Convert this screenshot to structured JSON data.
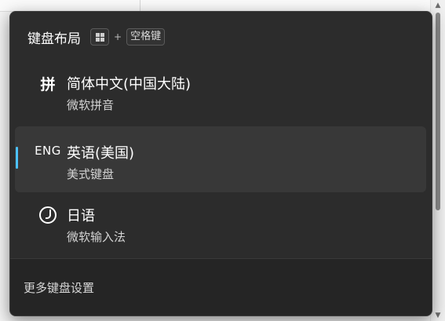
{
  "flyout": {
    "title": "键盘布局",
    "shortcut_plus": "+",
    "shortcut_space": "空格键",
    "items": [
      {
        "glyph": "拼",
        "name": "简体中文(中国大陆)",
        "sub": "微软拼音",
        "selected": false
      },
      {
        "glyph": "ENG",
        "name": "英语(美国)",
        "sub": "美式键盘",
        "selected": true
      },
      {
        "glyph": "japanese-ime-icon",
        "name": "日语",
        "sub": "微软输入法",
        "selected": false
      }
    ],
    "footer_link": "更多键盘设置"
  },
  "colors": {
    "flyout_bg": "#2c2c2c",
    "selected_bg": "#383838",
    "accent": "#4cc2ff",
    "footer_bg": "#252525"
  },
  "icons": {
    "windows_key": "windows-logo-icon",
    "scroll_up": "▲",
    "scroll_down": "▼"
  }
}
